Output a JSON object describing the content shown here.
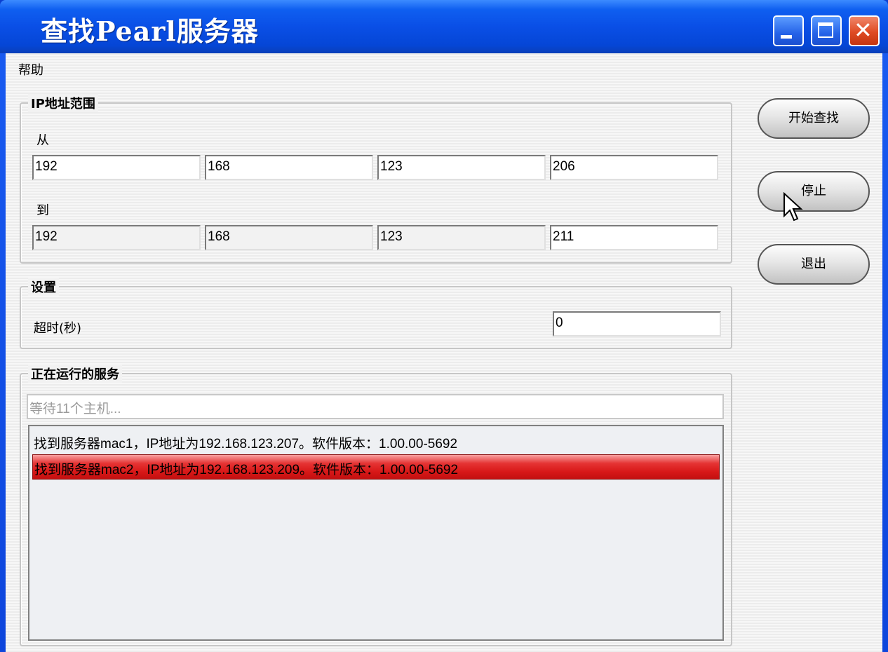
{
  "window": {
    "title": "查找Pearl服务器"
  },
  "menu": {
    "help": "帮助"
  },
  "ip_range": {
    "title": "IP地址范围",
    "from_label": "从",
    "to_label": "到",
    "from": [
      "192",
      "168",
      "123",
      "206"
    ],
    "to": [
      "192",
      "168",
      "123",
      "211"
    ]
  },
  "settings": {
    "title": "设置",
    "timeout_label": "超时(秒)",
    "timeout_value": "0"
  },
  "services": {
    "title": "正在运行的服务",
    "status": "等待11个主机...",
    "rows": [
      "找到服务器mac1，IP地址为192.168.123.207。软件版本：1.00.00-5692",
      "找到服务器mac2，IP地址为192.168.123.209。软件版本：1.00.00-5692"
    ],
    "selected_index": 1
  },
  "buttons": {
    "start": "开始查找",
    "stop": "停止",
    "exit": "退出"
  },
  "colors": {
    "titlebar": "#0a4fe6",
    "selection": "#d81818",
    "close_button": "#df4b24"
  }
}
